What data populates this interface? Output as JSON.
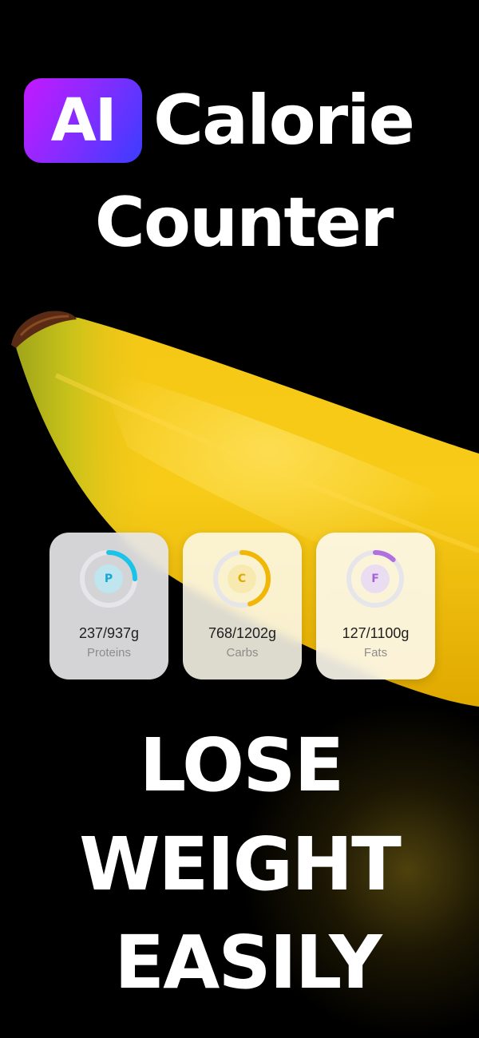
{
  "title": {
    "badge": "AI",
    "word1": "Calorie",
    "word2": "Counter"
  },
  "macros": [
    {
      "letter": "P",
      "amount": "237/937g",
      "label": "Proteins",
      "progress": 0.25,
      "color": "#1cc3e8",
      "letter_color": "#19a6d6",
      "inner_color": "#bfe6ef"
    },
    {
      "letter": "C",
      "amount": "768/1202g",
      "label": "Carbs",
      "progress": 0.45,
      "color": "#f2b705",
      "letter_color": "#e0a800",
      "inner_color": "#f8e9b0"
    },
    {
      "letter": "F",
      "amount": "127/1100g",
      "label": "Fats",
      "progress": 0.12,
      "color": "#b070e0",
      "letter_color": "#a562d8",
      "inner_color": "#eadcf1"
    }
  ],
  "slogan": {
    "line1": "LOSE",
    "line2": "WEIGHT",
    "line3": "EASILY"
  }
}
